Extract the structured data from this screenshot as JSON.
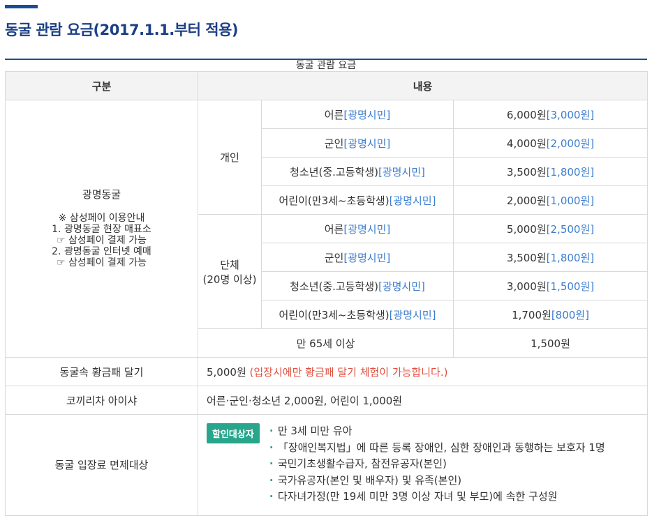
{
  "title": "동굴 관람 요금(2017.1.1.부터 적용)",
  "caption": "동굴 관람 요금",
  "headers": {
    "category": "구분",
    "content": "내용"
  },
  "cave": {
    "name": "광명동굴",
    "notes": [
      "※ 삼성페이 이용안내",
      "1. 광명동굴 현장 매표소",
      "☞ 삼성페이 결제 가능",
      "2. 광명동굴 인터넷 예매",
      "☞ 삼성페이 결제 가능"
    ],
    "individual_label": "개인",
    "group_label": "단체",
    "group_sub": "(20명 이상)",
    "citizen_tag": "[광명시민]",
    "individual": [
      {
        "type": "어른",
        "price": "6,000원",
        "citizen": "[3,000원]"
      },
      {
        "type": "군인",
        "price": "4,000원",
        "citizen": "[2,000원]"
      },
      {
        "type": "청소년(중.고등학생)",
        "price": "3,500원",
        "citizen": "[1,800원]"
      },
      {
        "type": "어린이(만3세~초등학생)",
        "price": "2,000원",
        "citizen": "[1,000원]"
      }
    ],
    "group": [
      {
        "type": "어른",
        "price": "5,000원",
        "citizen": "[2,500원]"
      },
      {
        "type": "군인",
        "price": "3,500원",
        "citizen": "[1,800원]"
      },
      {
        "type": "청소년(중.고등학생)",
        "price": "3,000원",
        "citizen": "[1,500원]"
      },
      {
        "type": "어린이(만3세~초등학생)",
        "price": "1,700원",
        "citizen": "[800원]"
      }
    ],
    "senior": {
      "label": "만 65세 이상",
      "price": "1,500원"
    }
  },
  "gold_plaque": {
    "label": "동굴속 황금패 달기",
    "price": "5,000원",
    "note": "(입장시에만 황금패 달기 체험이 가능합니다.)"
  },
  "elephant": {
    "label": "코끼리차 아이샤",
    "price": "어른·군인·청소년 2,000원, 어린이 1,000원"
  },
  "exemption": {
    "label": "동굴 입장료 면제대상",
    "badge": "할인대상자",
    "items": [
      "만 3세 미만 유아",
      "「장애인복지법」에 따른 등록 장애인, 심한 장애인과 동행하는 보호자 1명",
      "국민기초생활수급자, 참전유공자(본인)",
      "국가유공자(본인 및 배우자) 및 유족(본인)",
      "다자녀가정(만 19세 미만 3명 이상 자녀 및 부모)에 속한 구성원"
    ]
  },
  "colors": {
    "accent": "#1a4d96",
    "citizen_blue": "#3c7dcf",
    "note_red": "#e0503f",
    "badge_green": "#27a68c"
  }
}
